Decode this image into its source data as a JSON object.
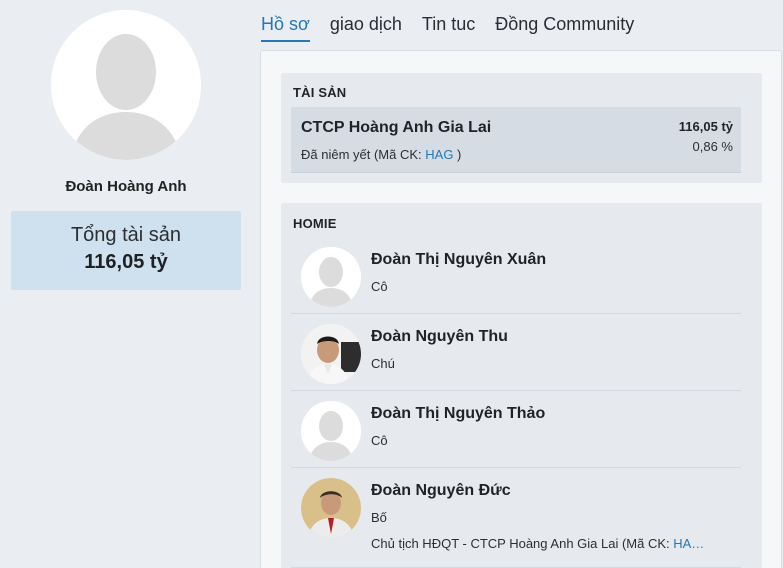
{
  "profile": {
    "name": "Đoàn Hoàng Anh",
    "assets_label": "Tổng tài sản",
    "assets_value": "116,05 tỷ"
  },
  "tabs": [
    {
      "label": "Hồ sơ",
      "active": true
    },
    {
      "label": "giao dịch",
      "active": false
    },
    {
      "label": "Tin tuc",
      "active": false
    },
    {
      "label": "Đồng Community",
      "active": false
    }
  ],
  "assets": {
    "title": "TÀI SẢN",
    "items": [
      {
        "company": "CTCP Hoàng Anh Gia Lai",
        "listing_prefix": "Đã niêm yết (Mã CK: ",
        "ticker": "HAG",
        "listing_suffix": " )",
        "amount": "116,05 tỷ",
        "percent": "0,86 %"
      }
    ]
  },
  "homie": {
    "title": "HOMIE",
    "members": [
      {
        "name": "Đoàn Thị Nguyên Xuân",
        "relation": "Cô",
        "role": "",
        "avatar": "placeholder-avatar"
      },
      {
        "name": "Đoàn Nguyên Thu",
        "relation": "Chú",
        "role": "",
        "avatar": "photo-avatar"
      },
      {
        "name": "Đoàn Thị Nguyên Thảo",
        "relation": "Cô",
        "role": "",
        "avatar": "placeholder-avatar"
      },
      {
        "name": "Đoàn Nguyên Đức",
        "relation": "Bố",
        "role_prefix": "Chủ tịch HĐQT - CTCP Hoàng Anh Gia Lai (Mã CK: ",
        "role_ticker": "HA…",
        "avatar": "photo-avatar"
      }
    ]
  },
  "colors": {
    "accent": "#2677b6",
    "page_bg": "#eaeef3",
    "assets_box_bg": "#cfe0ee"
  }
}
